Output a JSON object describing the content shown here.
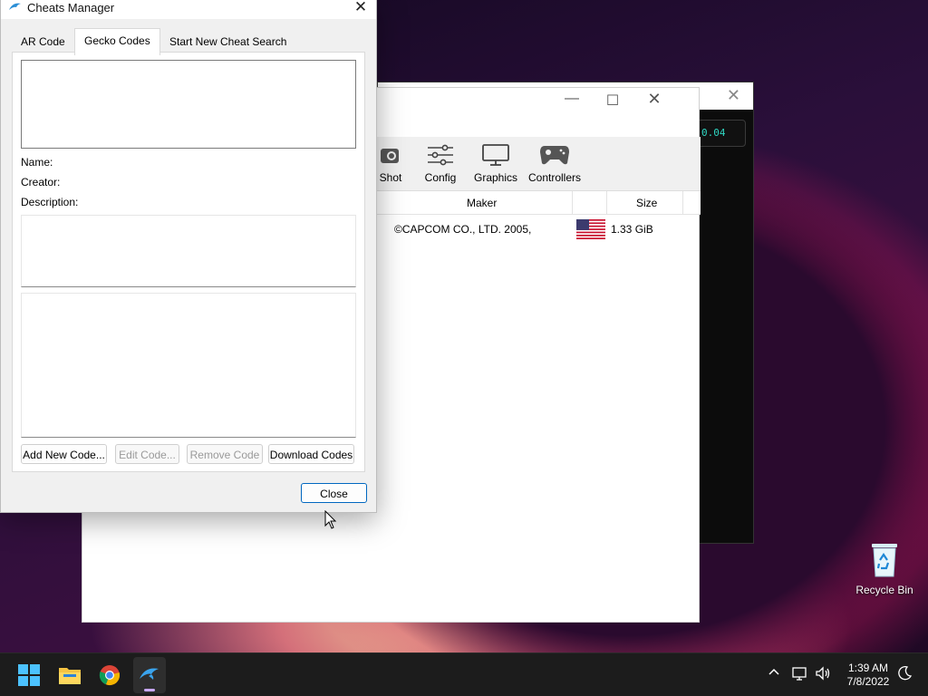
{
  "desktop": {
    "recycle_bin_label": "Recycle Bin"
  },
  "console": {
    "fps_text": "0.04"
  },
  "dolphin": {
    "toolbar": [
      {
        "label": "Shot",
        "icon": "camera-icon"
      },
      {
        "label": "Config",
        "icon": "sliders-icon"
      },
      {
        "label": "Graphics",
        "icon": "monitor-icon"
      },
      {
        "label": "Controllers",
        "icon": "gamepad-icon"
      }
    ],
    "columns": {
      "maker": "Maker",
      "size": "Size"
    },
    "rows": [
      {
        "maker": "©CAPCOM CO., LTD. 2005,",
        "region_icon": "us-flag-icon",
        "size": "1.33 GiB"
      }
    ]
  },
  "cheats": {
    "title": "Cheats Manager",
    "tabs": [
      "AR Code",
      "Gecko Codes",
      "Start New Cheat Search"
    ],
    "active_tab": "Gecko Codes",
    "name_label": "Name:",
    "creator_label": "Creator:",
    "description_label": "Description:",
    "buttons": {
      "add": "Add New Code...",
      "edit": "Edit Code...",
      "remove": "Remove Code",
      "download": "Download Codes",
      "close": "Close"
    },
    "accent_color": "#0067c0"
  },
  "taskbar": {
    "time": "1:39 AM",
    "date": "7/8/2022"
  }
}
